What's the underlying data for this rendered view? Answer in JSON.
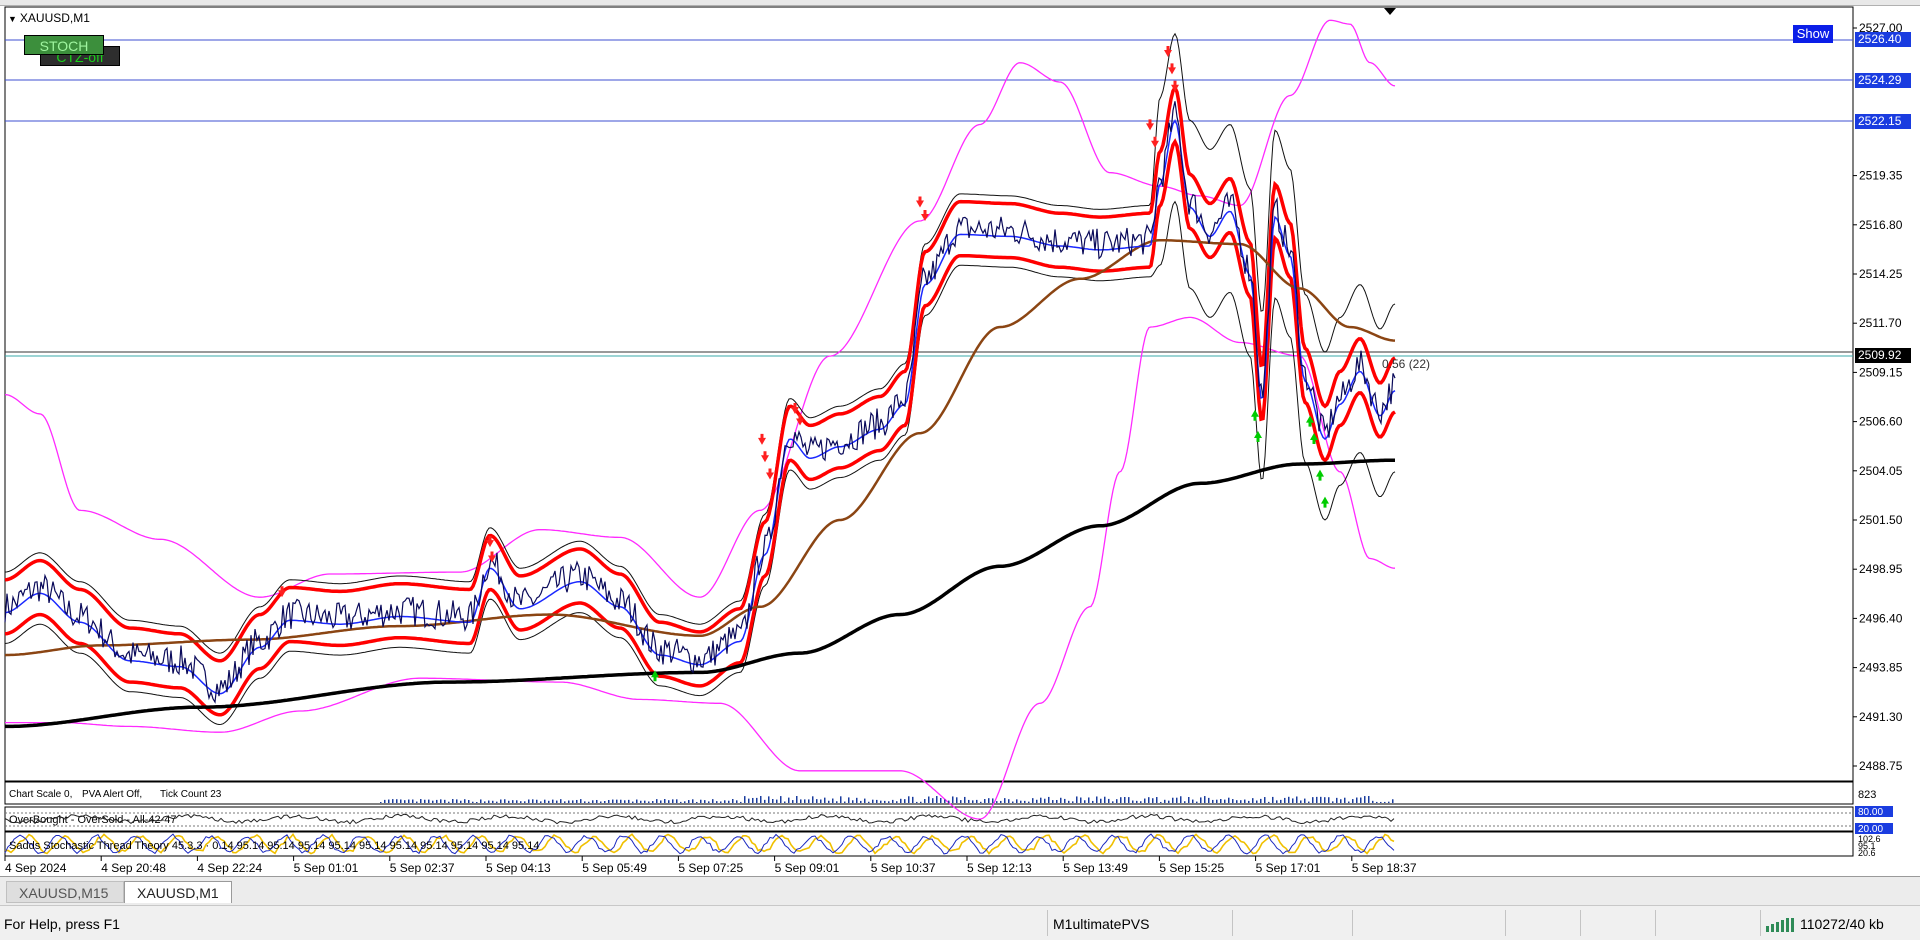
{
  "chart": {
    "symbol": "XAUUSD,M1",
    "show_button": "Show",
    "buttons": {
      "stoch": "STOCH",
      "ctz": "CTZ-off"
    },
    "price_axis": [
      "2527.00",
      "2526.40",
      "2524.29",
      "2522.15",
      "2519.35",
      "2516.80",
      "2514.25",
      "2511.70",
      "2509.92",
      "2509.15",
      "2506.60",
      "2504.05",
      "2501.50",
      "2498.95",
      "2496.40",
      "2493.85",
      "2491.30",
      "2488.75"
    ],
    "level_tags": {
      "l1": "2526.40",
      "l2": "2524.29",
      "l3": "2522.15",
      "current": "2509.92"
    },
    "spread_label": "0.56 (22)",
    "time_axis": [
      "4 Sep 2024",
      "4 Sep 20:48",
      "4 Sep 22:24",
      "5 Sep 01:01",
      "5 Sep 02:37",
      "5 Sep 04:13",
      "5 Sep 05:49",
      "5 Sep 07:25",
      "5 Sep 09:01",
      "5 Sep 10:37",
      "5 Sep 12:13",
      "5 Sep 13:49",
      "5 Sep 15:25",
      "5 Sep 17:01",
      "5 Sep 18:37"
    ],
    "info_line": {
      "scale": "Chart Scale 0,",
      "alert": "PVA Alert Off,",
      "ticks": "Tick Count 23"
    },
    "volume_axis_label": "823",
    "indicator1": {
      "label": "OverBought - OverSold - All-42-47",
      "levels": [
        "80.00",
        "20.00"
      ]
    },
    "indicator2": {
      "label": "Sadds Stochastic Thread Theory 45.3.3 · 0.14 95.14 95.14 95.14 95.14 95.14 95.14 95.14 95.14 95.14 95.14",
      "levels": [
        "102.6",
        "95.1",
        "20.6"
      ]
    }
  },
  "tabs": [
    "XAUUSD,M15",
    "XAUUSD,M1"
  ],
  "status": {
    "help": "For Help, press F1",
    "profile": "M1ultimatePVS",
    "traffic": "110272/40 kb"
  },
  "colors": {
    "price": "#0a0a5a",
    "ma_red": "#ff0000",
    "ma_brown": "#8b4513",
    "ma_black": "#000000",
    "band_magenta": "#ff2aff",
    "ma_blue": "#1a28ff",
    "arrow_up": "#00cc00",
    "tag_blue": "#1a3ce0"
  }
}
